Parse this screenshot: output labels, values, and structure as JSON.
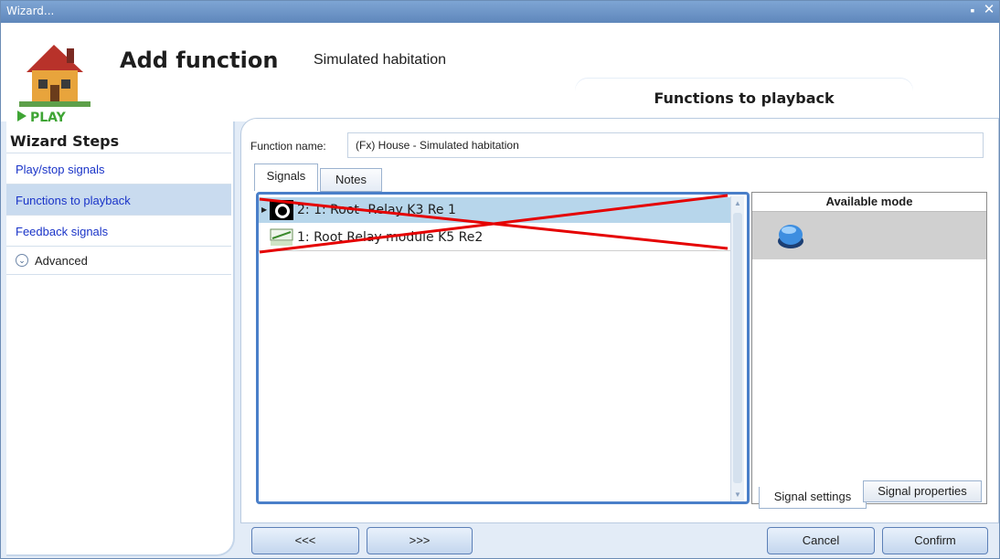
{
  "window": {
    "title": "Wizard...",
    "maximize_icon": "maximize-icon",
    "close_icon": "close-icon"
  },
  "header": {
    "logo_text": "PLAY",
    "title": "Add function",
    "subtitle": "Simulated habitation",
    "current_step": "Functions to playback"
  },
  "sidebar": {
    "title": "Wizard Steps",
    "items": [
      {
        "label": "Play/stop signals",
        "active": false
      },
      {
        "label": "Functions to playback",
        "active": true
      },
      {
        "label": "Feedback signals",
        "active": false
      }
    ],
    "advanced_label": "Advanced"
  },
  "form": {
    "function_name_label": "Function name:",
    "function_name_value": "(Fx) House - Simulated habitation"
  },
  "tabs": {
    "signals": "Signals",
    "notes": "Notes"
  },
  "signals_list": [
    {
      "label": "2: 1: Root -Relay K3 Re 1",
      "icon": "push-button-icon",
      "selected": true
    },
    {
      "label": "1: Root Relay module K5 Re2",
      "icon": "relay-module-icon",
      "selected": false
    }
  ],
  "modes_panel": {
    "header": "Available mode",
    "mode_icon": "blue-button-icon"
  },
  "bottom_tabs": {
    "settings": "Signal settings",
    "properties": "Signal properties"
  },
  "buttons": {
    "prev": "<<<",
    "next": ">>>",
    "cancel": "Cancel",
    "confirm": "Confirm"
  },
  "colors": {
    "strike_cross": "#e50000",
    "accent": "#4a7fc9",
    "selection": "#b7d6eb"
  }
}
